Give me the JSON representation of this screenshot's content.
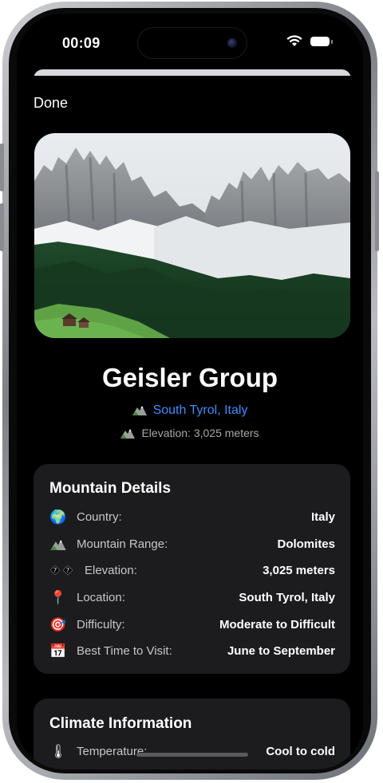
{
  "status_bar": {
    "time": "00:09"
  },
  "nav": {
    "done_label": "Done"
  },
  "header": {
    "title": "Geisler Group",
    "location": "South Tyrol, Italy",
    "elevation_line": "Elevation: 3,025 meters"
  },
  "mountain_details": {
    "title": "Mountain Details",
    "rows": [
      {
        "icon": "globe-icon",
        "label": "Country:",
        "value": "Italy"
      },
      {
        "icon": "mountain-icon",
        "label": "Mountain Range:",
        "value": "Dolomites"
      },
      {
        "icon": "missing-glyph-icon",
        "label": "Elevation:",
        "value": "3,025 meters"
      },
      {
        "icon": "pin-icon",
        "label": "Location:",
        "value": "South Tyrol, Italy"
      },
      {
        "icon": "target-icon",
        "label": "Difficulty:",
        "value": "Moderate to Difficult"
      },
      {
        "icon": "calendar-icon",
        "label": "Best Time to Visit:",
        "value": "June to September"
      }
    ]
  },
  "climate": {
    "title": "Climate Information",
    "rows": [
      {
        "icon": "thermometer-icon",
        "label": "Temperature:",
        "value": "Cool to cold"
      }
    ]
  },
  "colors": {
    "accent": "#3a8dff",
    "card_bg": "#1c1c1e",
    "background": "#000000"
  }
}
